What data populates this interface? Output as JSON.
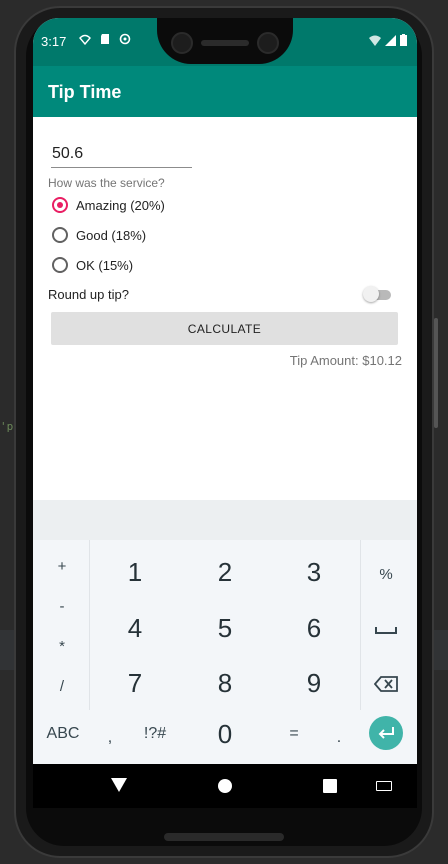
{
  "ide": {
    "code_snippet": "'p"
  },
  "status_bar": {
    "time": "3:17",
    "left_icons": [
      "wifi-calling-icon",
      "sd-card-icon",
      "sync-icon"
    ],
    "right_icons": [
      "wifi-icon",
      "signal-icon",
      "battery-icon"
    ]
  },
  "app": {
    "title": "Tip Time"
  },
  "form": {
    "cost_value": "50.6",
    "service_question": "How was the service?",
    "options": [
      {
        "label": "Amazing (20%)",
        "checked": true
      },
      {
        "label": "Good (18%)",
        "checked": false
      },
      {
        "label": "OK (15%)",
        "checked": false
      }
    ],
    "round_up_label": "Round up tip?",
    "round_up_enabled": false,
    "calculate_label": "CALCULATE",
    "tip_amount": "Tip Amount: $10.12"
  },
  "keyboard": {
    "left_column": [
      "+",
      "-",
      "*",
      "/"
    ],
    "digits": [
      "1",
      "2",
      "3",
      "4",
      "5",
      "6",
      "7",
      "8",
      "9"
    ],
    "right_column": [
      "%",
      "space-icon",
      "backspace-icon"
    ],
    "bottom_row": {
      "abc": "ABC",
      "comma": ",",
      "symbols": "!?#",
      "zero": "0",
      "equals": "=",
      "period": "."
    },
    "accent_color": "#40b4a9"
  },
  "colors": {
    "status_bar": "#00796b",
    "app_bar": "#00897b",
    "radio_checked": "#e91e63"
  }
}
